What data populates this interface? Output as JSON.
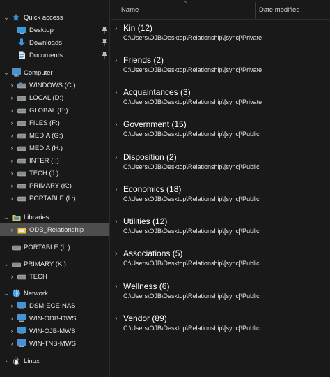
{
  "nav": {
    "quick_access": {
      "label": "Quick access",
      "items": [
        {
          "label": "Desktop"
        },
        {
          "label": "Downloads"
        },
        {
          "label": "Documents"
        }
      ]
    },
    "computer": {
      "label": "Computer",
      "drives": [
        {
          "label": "WINDOWS (C:)"
        },
        {
          "label": "LOCAL (D:)"
        },
        {
          "label": "GLOBAL (E:)"
        },
        {
          "label": "FILES (F:)"
        },
        {
          "label": "MEDIA (G:)"
        },
        {
          "label": "MEDIA (H:)"
        },
        {
          "label": "INTER (I:)"
        },
        {
          "label": "TECH (J:)"
        },
        {
          "label": "PRIMARY (K:)"
        },
        {
          "label": "PORTABLE (L:)"
        }
      ]
    },
    "libraries": {
      "label": "Libraries",
      "items": [
        {
          "label": "ODB_Relationship"
        }
      ]
    },
    "portable": {
      "label": "PORTABLE (L:)"
    },
    "primary": {
      "label": "PRIMARY (K:)",
      "items": [
        {
          "label": "TECH"
        }
      ]
    },
    "network": {
      "label": "Network",
      "items": [
        {
          "label": "DSM-ECE-NAS"
        },
        {
          "label": "WIN-ODB-DWS"
        },
        {
          "label": "WIN-OJB-MWS"
        },
        {
          "label": "WIN-TNB-MWS"
        }
      ]
    },
    "linux": {
      "label": "Linux"
    }
  },
  "header": {
    "name_label": "Name",
    "date_label": "Date modified"
  },
  "groups": [
    {
      "title": "Kin (12)",
      "path": "C:\\Users\\OJB\\Desktop\\Relationship\\[sync]\\Private"
    },
    {
      "title": "Friends (2)",
      "path": "C:\\Users\\OJB\\Desktop\\Relationship\\[sync]\\Private"
    },
    {
      "title": "Acquaintances (3)",
      "path": "C:\\Users\\OJB\\Desktop\\Relationship\\[sync]\\Private"
    },
    {
      "title": "Government (15)",
      "path": "C:\\Users\\OJB\\Desktop\\Relationship\\[sync]\\Public"
    },
    {
      "title": "Disposition (2)",
      "path": "C:\\Users\\OJB\\Desktop\\Relationship\\[sync]\\Public"
    },
    {
      "title": "Economics (18)",
      "path": "C:\\Users\\OJB\\Desktop\\Relationship\\[sync]\\Public"
    },
    {
      "title": "Utilities (12)",
      "path": "C:\\Users\\OJB\\Desktop\\Relationship\\[sync]\\Public"
    },
    {
      "title": "Associations (5)",
      "path": "C:\\Users\\OJB\\Desktop\\Relationship\\[sync]\\Public"
    },
    {
      "title": "Wellness (6)",
      "path": "C:\\Users\\OJB\\Desktop\\Relationship\\[sync]\\Public"
    },
    {
      "title": "Vendor (89)",
      "path": "C:\\Users\\OJB\\Desktop\\Relationship\\[sync]\\Public"
    }
  ],
  "colors": {
    "background": "#191919",
    "selected": "#4d4d4d",
    "accent": "#3a96dd"
  },
  "icons": {
    "quick_access": "star-icon",
    "desktop": "desktop-icon",
    "downloads": "download-arrow-icon",
    "documents": "document-icon",
    "computer": "computer-icon",
    "drive": "drive-icon",
    "library": "library-icon",
    "network": "network-icon",
    "linux": "linux-penguin-icon",
    "pin": "pin-icon"
  }
}
